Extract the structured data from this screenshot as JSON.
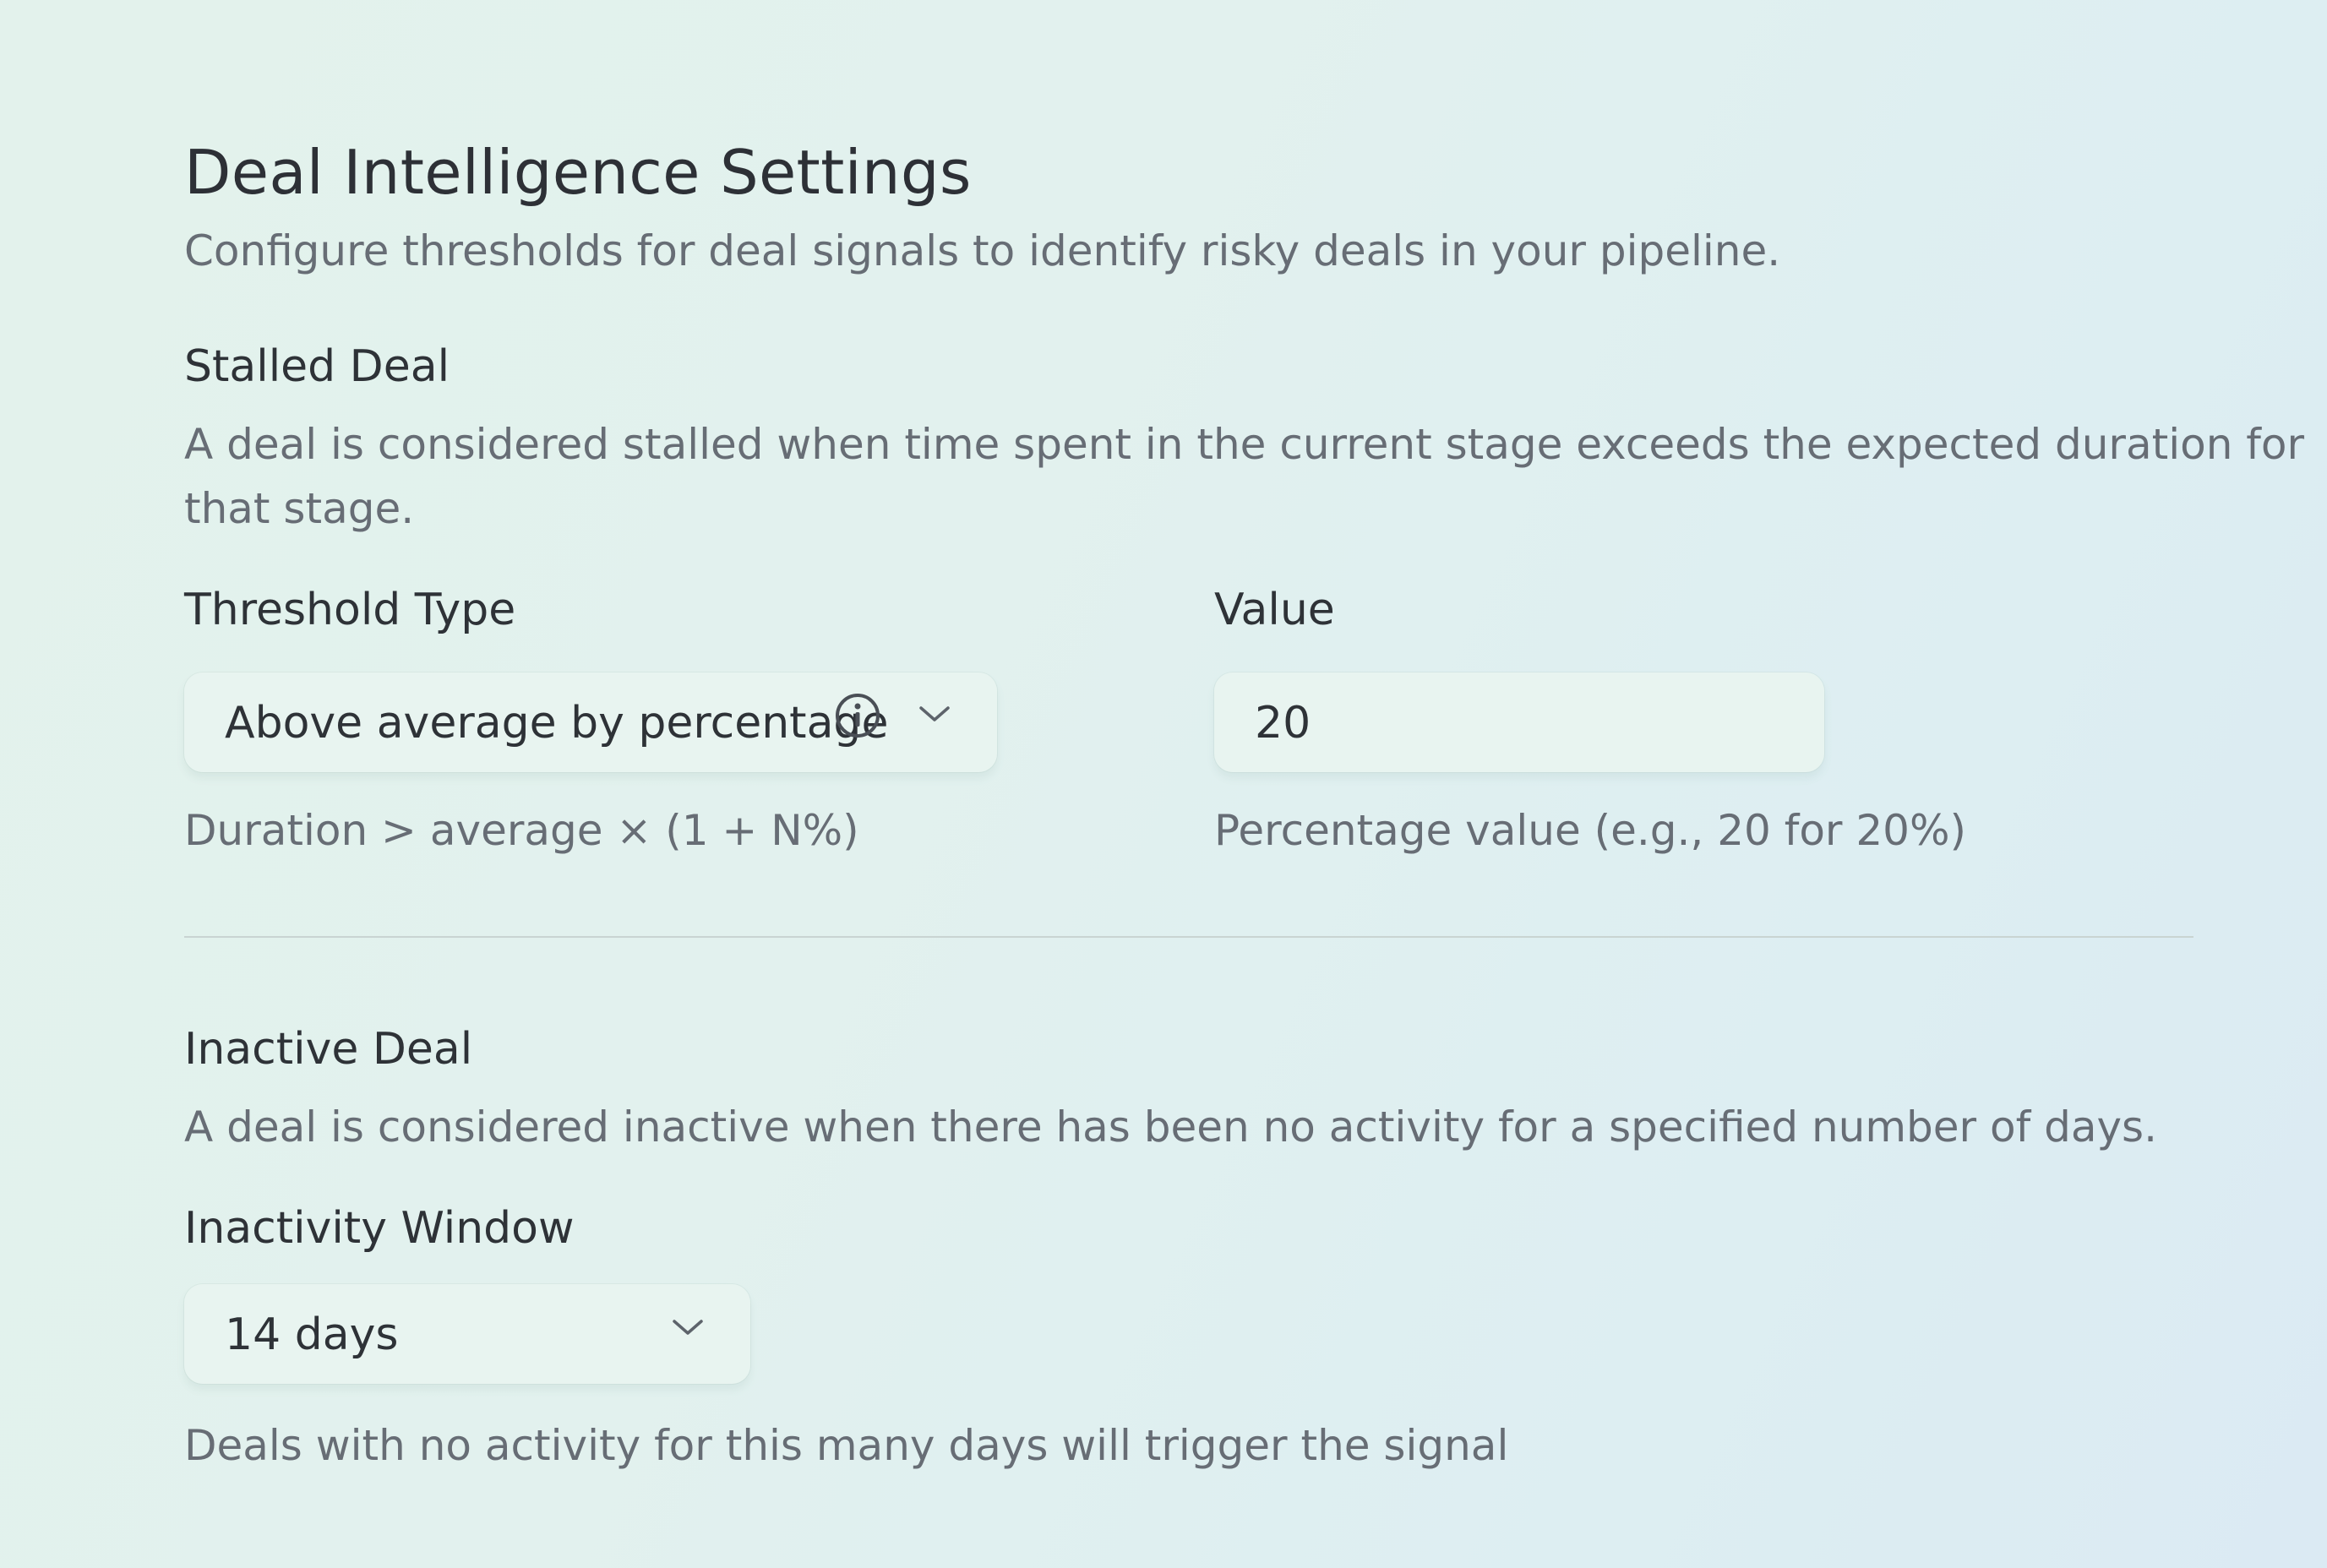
{
  "page": {
    "title": "Deal Intelligence Settings",
    "subtitle": "Configure thresholds for deal signals to identify risky deals in your pipeline."
  },
  "stalled": {
    "title": "Stalled Deal",
    "description_line1": "A deal is considered stalled when time spent in the current stage exceeds the expected duration for",
    "description_line2": "that stage.",
    "threshold_type": {
      "label": "Threshold Type",
      "selected": "Above average by percentage",
      "hint": "Duration > average × (1 + N%)",
      "info_icon": "info-icon",
      "dropdown_icon": "chevron-down-icon"
    },
    "value": {
      "label": "Value",
      "current": "20",
      "hint": "Percentage value (e.g., 20 for 20%)"
    }
  },
  "inactive": {
    "title": "Inactive Deal",
    "description": "A deal is considered inactive when there has been no activity for a specified number of days.",
    "window": {
      "label": "Inactivity Window",
      "selected": "14 days",
      "hint": "Deals with no activity for this many days will trigger the signal",
      "dropdown_icon": "chevron-down-icon"
    }
  }
}
